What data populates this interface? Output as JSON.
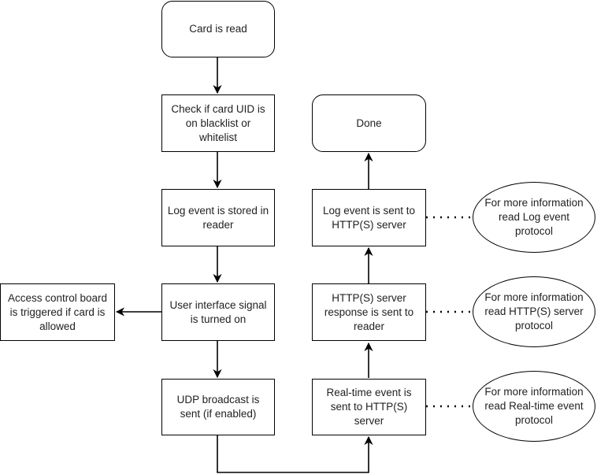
{
  "diagram": {
    "type": "flowchart",
    "nodes": {
      "card_read": "Card is read",
      "check_uid": "Check if card UID is on blacklist or whitelist",
      "log_stored": "Log event is stored in reader",
      "ui_signal": "User interface signal is turned on",
      "access_board": "Access control board is triggered if card is allowed",
      "udp_broadcast": "UDP broadcast is sent (if enabled)",
      "realtime_event": "Real-time event is sent to HTTP(S) server",
      "server_response": "HTTP(S) server response is sent to reader",
      "log_sent": "Log event is sent to HTTP(S) server",
      "done": "Done",
      "note_log": "For more information read Log event protocol",
      "note_server": "For more information read HTTP(S) server protocol",
      "note_realtime": "For more information read Real-time event protocol"
    },
    "edges": [
      {
        "from": "card_read",
        "to": "check_uid",
        "style": "arrow"
      },
      {
        "from": "check_uid",
        "to": "log_stored",
        "style": "arrow"
      },
      {
        "from": "log_stored",
        "to": "ui_signal",
        "style": "arrow"
      },
      {
        "from": "ui_signal",
        "to": "access_board",
        "style": "arrow"
      },
      {
        "from": "ui_signal",
        "to": "udp_broadcast",
        "style": "arrow"
      },
      {
        "from": "udp_broadcast",
        "to": "realtime_event",
        "style": "arrow"
      },
      {
        "from": "realtime_event",
        "to": "server_response",
        "style": "arrow"
      },
      {
        "from": "server_response",
        "to": "log_sent",
        "style": "arrow"
      },
      {
        "from": "log_sent",
        "to": "done",
        "style": "arrow"
      },
      {
        "from": "log_sent",
        "to": "note_log",
        "style": "dotted"
      },
      {
        "from": "server_response",
        "to": "note_server",
        "style": "dotted"
      },
      {
        "from": "realtime_event",
        "to": "note_realtime",
        "style": "dotted"
      }
    ]
  }
}
